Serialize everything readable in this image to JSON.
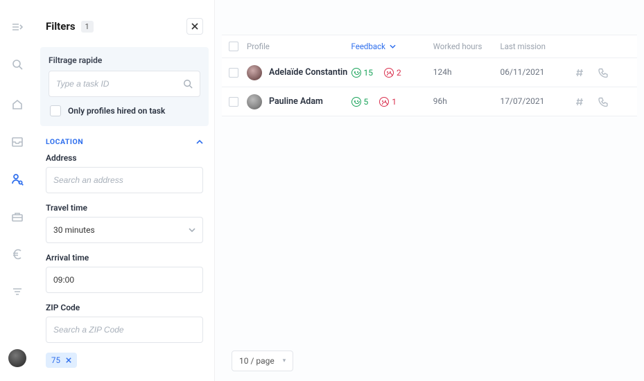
{
  "filters": {
    "title": "Filters",
    "badge": "1",
    "quick": {
      "label": "Filtrage rapide",
      "placeholder": "Type a task ID",
      "only_hired_label": "Only profiles hired on task"
    },
    "location": {
      "section_label": "Location",
      "address_label": "Address",
      "address_placeholder": "Search an address",
      "travel_label": "Travel time",
      "travel_value": "30 minutes",
      "arrival_label": "Arrival time",
      "arrival_value": "09:00",
      "zip_label": "ZIP Code",
      "zip_placeholder": "Search a ZIP Code",
      "zip_chip": "75"
    }
  },
  "table": {
    "headers": {
      "profile": "Profile",
      "feedback": "Feedback",
      "worked": "Worked hours",
      "last": "Last mission"
    },
    "rows": [
      {
        "name": "Adelaïde Constantin",
        "pos": "15",
        "neg": "2",
        "worked": "124h",
        "last": "06/11/2021"
      },
      {
        "name": "Pauline Adam",
        "pos": "5",
        "neg": "1",
        "worked": "96h",
        "last": "17/07/2021"
      }
    ]
  },
  "pager": {
    "label": "10 / page"
  }
}
